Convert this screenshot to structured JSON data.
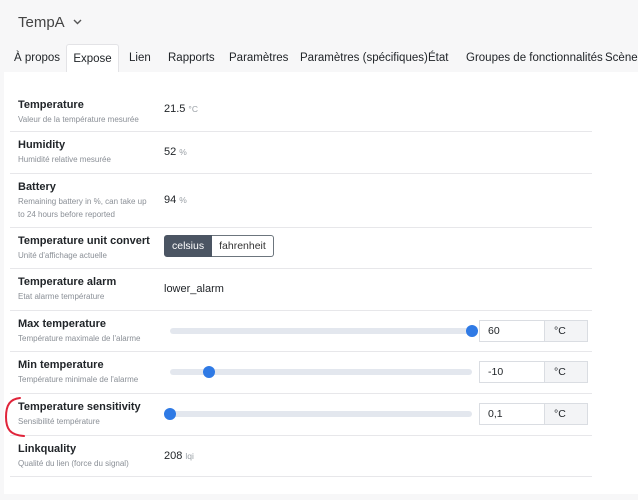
{
  "header": {
    "title": "TempA",
    "chevron_icon": "chevron-down-icon"
  },
  "tabs": [
    {
      "label": "À propos",
      "active": false
    },
    {
      "label": "Expose",
      "active": true
    },
    {
      "label": "Lien",
      "active": false
    },
    {
      "label": "Rapports",
      "active": false
    },
    {
      "label": "Paramètres",
      "active": false
    },
    {
      "label": "Paramètres (spécifiques)",
      "active": false
    },
    {
      "label": "État",
      "active": false
    },
    {
      "label": "Groupes de fonctionnalités",
      "active": false
    },
    {
      "label": "Scène",
      "active": false
    }
  ],
  "rows": {
    "temperature": {
      "label": "Temperature",
      "desc": "Valeur de la température mesurée",
      "value": "21.5",
      "unit": "°C"
    },
    "humidity": {
      "label": "Humidity",
      "desc": "Humidité relative mesurée",
      "value": "52",
      "unit": "%"
    },
    "battery": {
      "label": "Battery",
      "desc_line1": "Remaining battery in %, can take up",
      "desc_line2": "to 24 hours before reported",
      "value": "94",
      "unit": "%"
    },
    "unit_convert": {
      "label": "Temperature unit convert",
      "desc": "Unité d'affichage actuelle",
      "options": [
        "celsius",
        "fahrenheit"
      ],
      "selected": "celsius"
    },
    "alarm": {
      "label": "Temperature alarm",
      "desc": "Etat alarme température",
      "value": "lower_alarm"
    },
    "max_temp": {
      "label": "Max temperature",
      "desc": "Température maximale de l'alarme",
      "value": "60",
      "unit": "°C",
      "slider_fraction": 1.0
    },
    "min_temp": {
      "label": "Min temperature",
      "desc": "Température minimale de l'alarme",
      "value": "-10",
      "unit": "°C",
      "slider_fraction": 0.13
    },
    "sensitivity": {
      "label": "Temperature sensitivity",
      "desc": "Sensibilité température",
      "value": "0,1",
      "unit": "°C",
      "slider_fraction": 0.0
    },
    "linkquality": {
      "label": "Linkquality",
      "desc": "Qualité du lien (force du signal)",
      "value": "208",
      "unit": "lqi"
    }
  },
  "colors": {
    "accent": "#2f7ae5",
    "annotation": "#e0243a",
    "selected_button": "#4b5563"
  }
}
